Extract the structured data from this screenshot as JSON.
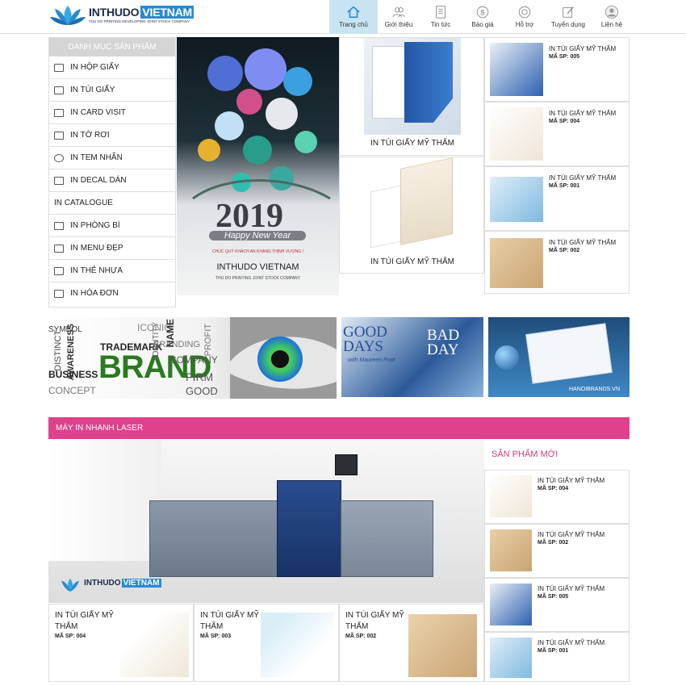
{
  "brand": {
    "name_a": "INTHUDO",
    "name_b": "VIETNAM",
    "tagline": "THU DO PRINTING DEVELOPING JOINT STOCK COMPANY"
  },
  "nav": [
    {
      "label": "Trang chủ",
      "icon": "home-icon"
    },
    {
      "label": "Giới thiệu",
      "icon": "users-icon"
    },
    {
      "label": "Tin tức",
      "icon": "news-icon"
    },
    {
      "label": "Báo giá",
      "icon": "dollar-icon"
    },
    {
      "label": "Hỗ trợ",
      "icon": "support-icon"
    },
    {
      "label": "Tuyển dụng",
      "icon": "edit-icon"
    },
    {
      "label": "Liên hệ",
      "icon": "user-icon"
    }
  ],
  "sidebar": {
    "heading": "DANH MỤC SẢN PHẨM",
    "items": [
      "IN HỘP GIẤY",
      "IN TÚI GIẤY",
      "IN CARD VISIT",
      "IN TỜ RƠI",
      "IN TEM NHÃN",
      "IN DECAL DÁN",
      "IN CATALOGUE",
      "IN PHÒNG BÌ",
      "IN MENU ĐẸP",
      "IN THẺ NHỰA",
      "IN HÓA ĐƠN"
    ]
  },
  "hero": {
    "year": "2019",
    "greet": "Happy New Year",
    "wish": "CHÚC QUÝ KHÁCH AN KHANG THỊNH VƯỢNG !",
    "company": "INTHUDO VIETNAM",
    "company_sub": "THU DO PRINTING JOINT STOCK COMPANY"
  },
  "center_products": [
    {
      "title": "IN TÚI GIẤY MỸ THẨM"
    },
    {
      "title": "IN TÚI GIẤY MỸ THẨM"
    }
  ],
  "right_products": [
    {
      "title": "IN TÚI GIẤY MỸ THẨM",
      "sp": "MÃ SP: 005"
    },
    {
      "title": "IN TÚI GIẤY MỸ THẨM",
      "sp": "MÃ SP: 004"
    },
    {
      "title": "IN TÚI GIẤY MỸ THẨM",
      "sp": "MÃ SP: 001"
    },
    {
      "title": "IN TÚI GIẤY MỸ THẨM",
      "sp": "MÃ SP: 002"
    }
  ],
  "banners": {
    "brand_words": [
      "BRAND",
      "TRADEMARK",
      "BUSINESS",
      "COMPANY",
      "FIRM",
      "GOOD",
      "CONCEPT",
      "AWARENESS",
      "IDENTITY",
      "BRANDING",
      "ICONIC",
      "NAME",
      "PROFIT",
      "DISTINCT",
      "SYMBOL"
    ],
    "good_days": "GOOD DAYS",
    "bad_day": "BAD DAY",
    "author": "with Maureen Pratt",
    "card_watermark": "HANOIBRANDS.VN"
  },
  "section": {
    "heading": "MÁY IN NHANH LASER"
  },
  "new_products": {
    "heading": "SẢN PHẨM MỚI",
    "items": [
      {
        "title": "IN TÚI GIẤY MỸ THẨM",
        "sp": "MÃ SP: 004"
      },
      {
        "title": "IN TÚI GIẤY MỸ THẨM",
        "sp": "MÃ SP: 002"
      },
      {
        "title": "IN TÚI GIẤY MỸ THẨM",
        "sp": "MÃ SP: 005"
      },
      {
        "title": "IN TÚI GIẤY MỸ THẨM",
        "sp": "MÃ SP: 001"
      }
    ]
  },
  "bottom_products": [
    {
      "title": "IN TÚI GIẤY MỸ THẨM",
      "sp": "MÃ SP: 004"
    },
    {
      "title": "IN TÚI GIẤY MỸ THẨM",
      "sp": "MÃ SP: 003"
    },
    {
      "title": "IN TÚI GIẤY MỸ THẨM",
      "sp": "MÃ SP: 002"
    }
  ],
  "colors": {
    "accent": "#e0408c",
    "nav_active": "#c8e4f2",
    "logo_blue": "#2a8ad0"
  }
}
